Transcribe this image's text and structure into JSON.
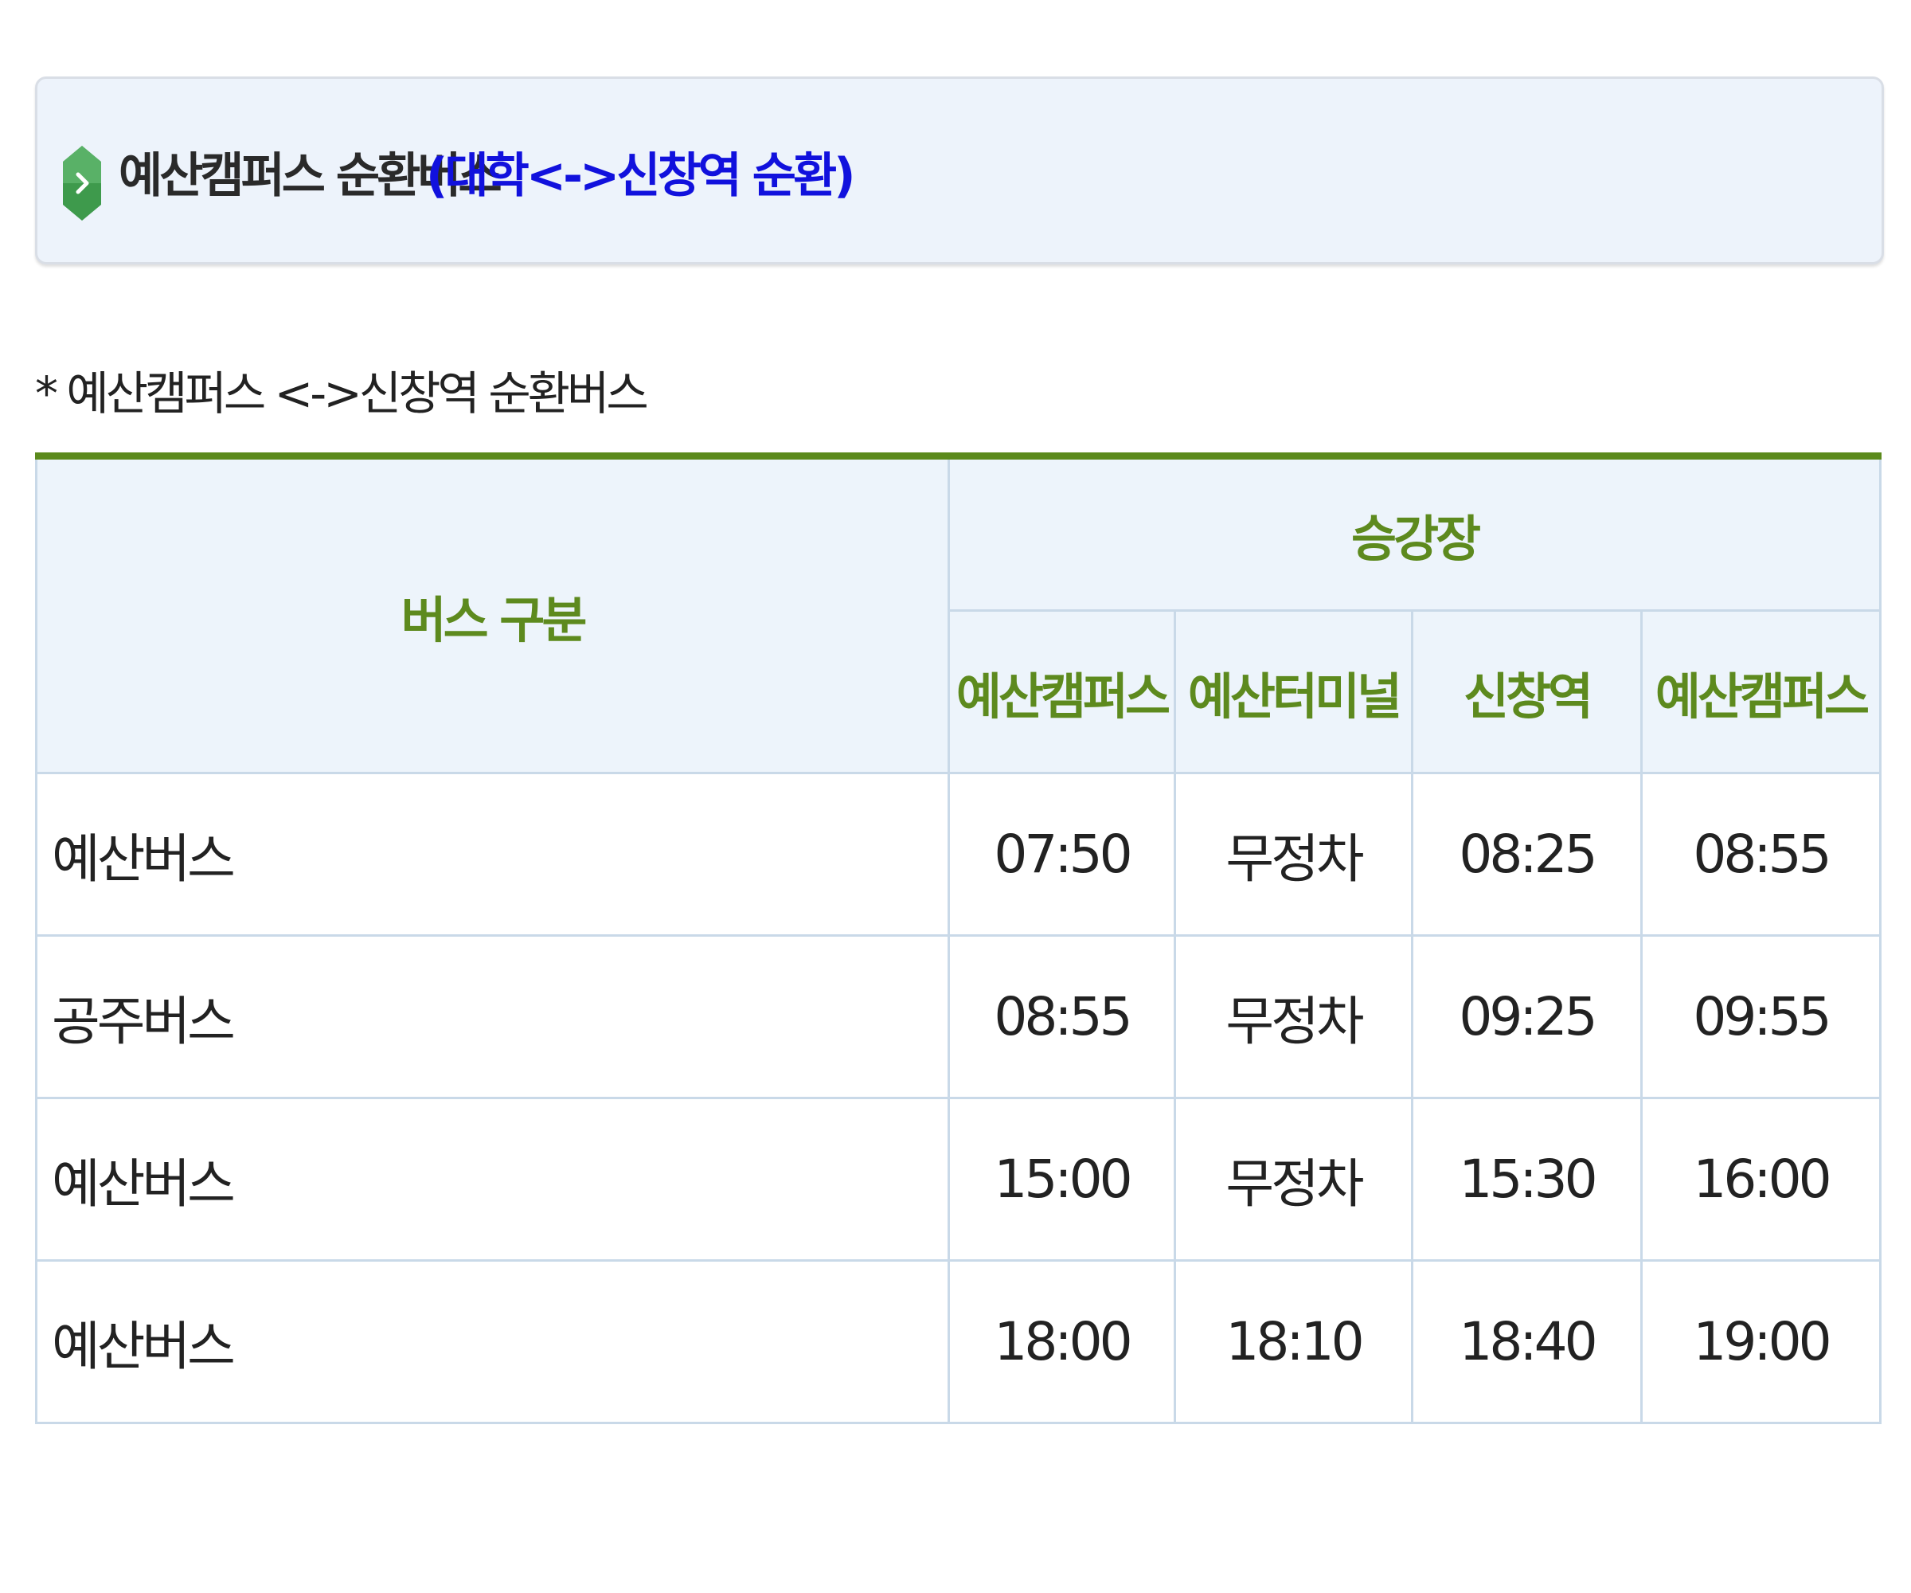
{
  "header": {
    "title": "예산캠퍼스 순환버스",
    "subtitle": "(대학<->신창역 순환)",
    "icon": "chevron-right-icon",
    "icon_color": "#3e9a4c"
  },
  "note": "* 예산캠퍼스 <->신창역 순환버스",
  "table": {
    "bus_type_header": "버스 구분",
    "stops_header": "승강장",
    "stops": [
      "예산캠퍼스",
      "예산터미널",
      "신창역",
      "예산캠퍼스"
    ],
    "rows": [
      {
        "bus": "예산버스",
        "times": [
          "07:50",
          "무정차",
          "08:25",
          "08:55"
        ]
      },
      {
        "bus": "공주버스",
        "times": [
          "08:55",
          "무정차",
          "09:25",
          "09:55"
        ]
      },
      {
        "bus": "예산버스",
        "times": [
          "15:00",
          "무정차",
          "15:30",
          "16:00"
        ]
      },
      {
        "bus": "예산버스",
        "times": [
          "18:00",
          "18:10",
          "18:40",
          "19:00"
        ]
      }
    ]
  },
  "colors": {
    "header_text": "#5d8a1e",
    "header_bg": "#edf4fb",
    "top_rule": "#5b8a1c",
    "subtitle": "#1111dd"
  }
}
